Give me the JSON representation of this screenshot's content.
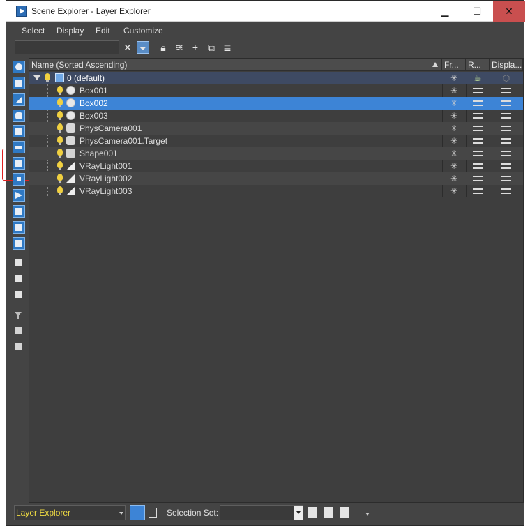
{
  "window": {
    "title": "Scene Explorer - Layer Explorer",
    "controls": {
      "minimize": "▁",
      "maximize": "☐",
      "close": "✕"
    }
  },
  "menu": [
    "Select",
    "Display",
    "Edit",
    "Customize"
  ],
  "toolbar": {
    "search_value": "",
    "icons": [
      "clear-search-icon",
      "filter-toggle-icon",
      "lock-icon",
      "add-to-layer-icon",
      "create-layer-icon",
      "select-layer-icon",
      "manage-layers-icon"
    ]
  },
  "columns": {
    "name": "Name (Sorted Ascending)",
    "frozen": "Fr...",
    "renderable": "R...",
    "display": "Displa..."
  },
  "tree": {
    "layer": "0 (default)",
    "objects": [
      {
        "name": "Box001",
        "type": "sphere",
        "selected": false
      },
      {
        "name": "Box002",
        "type": "sphere",
        "selected": true
      },
      {
        "name": "Box003",
        "type": "sphere",
        "selected": false
      },
      {
        "name": "PhysCamera001",
        "type": "camera",
        "selected": false
      },
      {
        "name": "PhysCamera001.Target",
        "type": "camera",
        "selected": false
      },
      {
        "name": "Shape001",
        "type": "shape",
        "selected": false
      },
      {
        "name": "VRayLight001",
        "type": "light",
        "selected": false
      },
      {
        "name": "VRayLight002",
        "type": "light",
        "selected": false
      },
      {
        "name": "VRayLight003",
        "type": "light",
        "selected": false
      }
    ]
  },
  "status": {
    "explorer": "Layer Explorer",
    "selection_label": "Selection Set:",
    "selection_value": ""
  },
  "colors": {
    "selected_row": "#3d84d6",
    "layer_row": "#3e4a63",
    "highlight_box": "#e02020",
    "explorer_text": "#f0dc42"
  }
}
